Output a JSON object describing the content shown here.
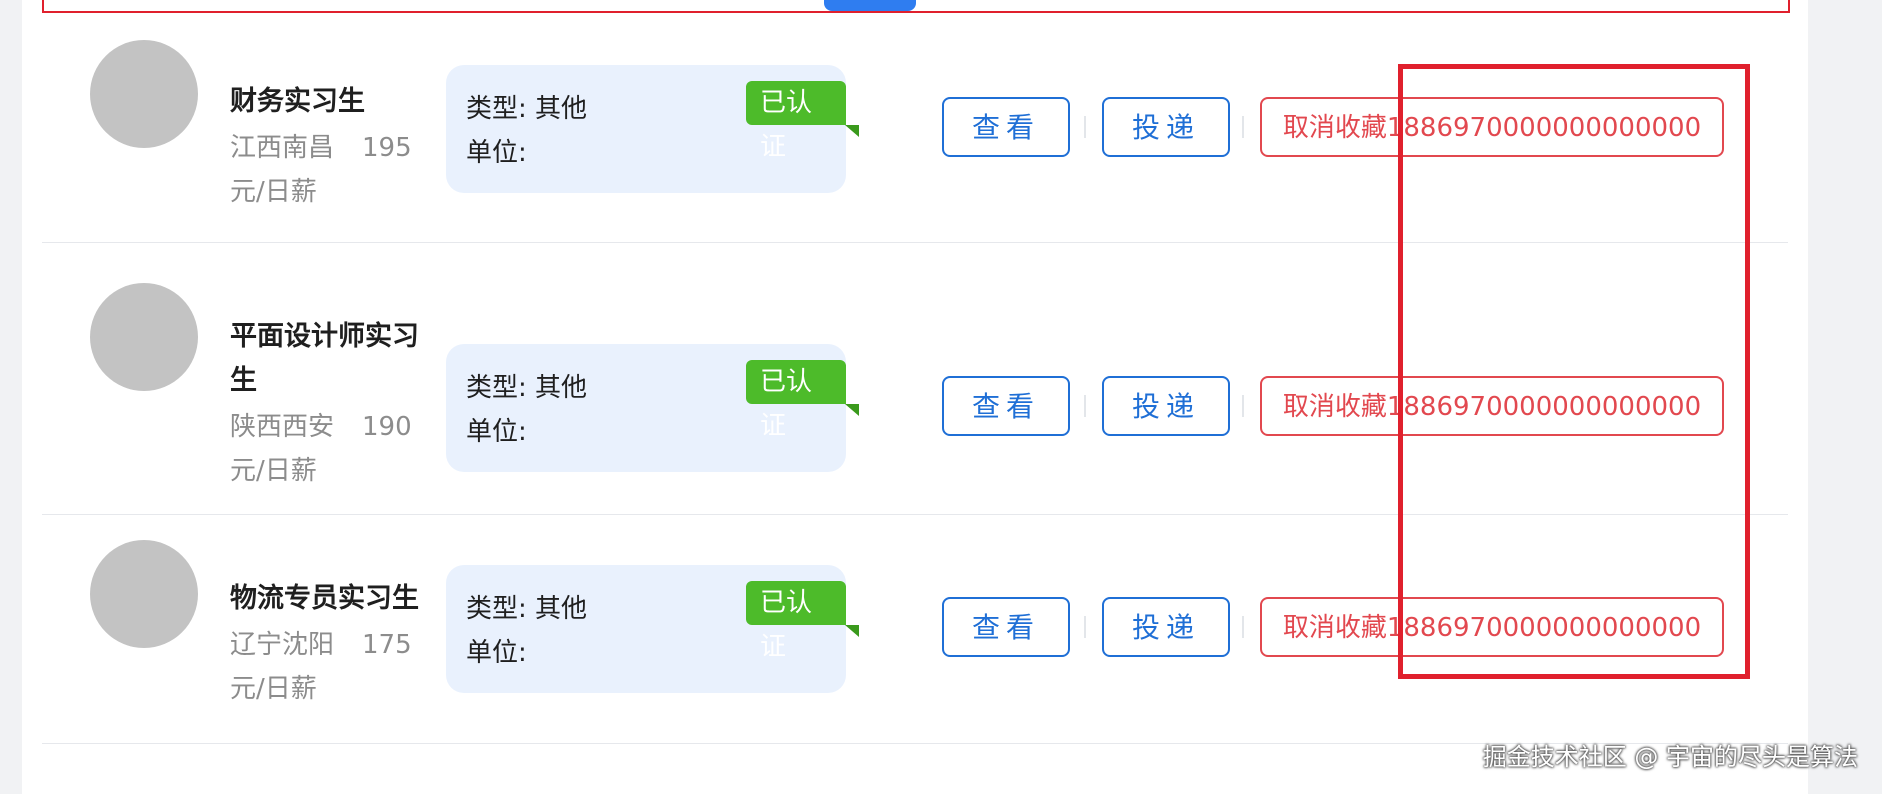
{
  "jobs": [
    {
      "title": "财务实习生",
      "location": "江西南昌",
      "salary_amount": "195",
      "salary_unit": "元/日薪",
      "type_label": "类型: 其他",
      "unit_label": "单位:",
      "badge": "已认证",
      "view_label": "查看",
      "apply_label": "投递",
      "cancel_label": "取消收藏1886970000000000000"
    },
    {
      "title": "平面设计师实习生",
      "location": "陕西西安",
      "salary_amount": "190",
      "salary_unit": "元/日薪",
      "type_label": "类型: 其他",
      "unit_label": "单位:",
      "badge": "已认证",
      "view_label": "查看",
      "apply_label": "投递",
      "cancel_label": "取消收藏1886970000000000000"
    },
    {
      "title": "物流专员实习生",
      "location": "辽宁沈阳",
      "salary_amount": "175",
      "salary_unit": "元/日薪",
      "type_label": "类型: 其他",
      "unit_label": "单位:",
      "badge": "已认证",
      "view_label": "查看",
      "apply_label": "投递",
      "cancel_label": "取消收藏1886970000000000000"
    }
  ],
  "watermark": "掘金技术社区 @ 宇宙的尽头是算法",
  "colors": {
    "accent_blue": "#1f6fd6",
    "cancel_red": "#e2484f",
    "badge_green": "#4dbb2a",
    "card_bg": "#e9f1fd",
    "highlight_red": "#e0202d"
  }
}
